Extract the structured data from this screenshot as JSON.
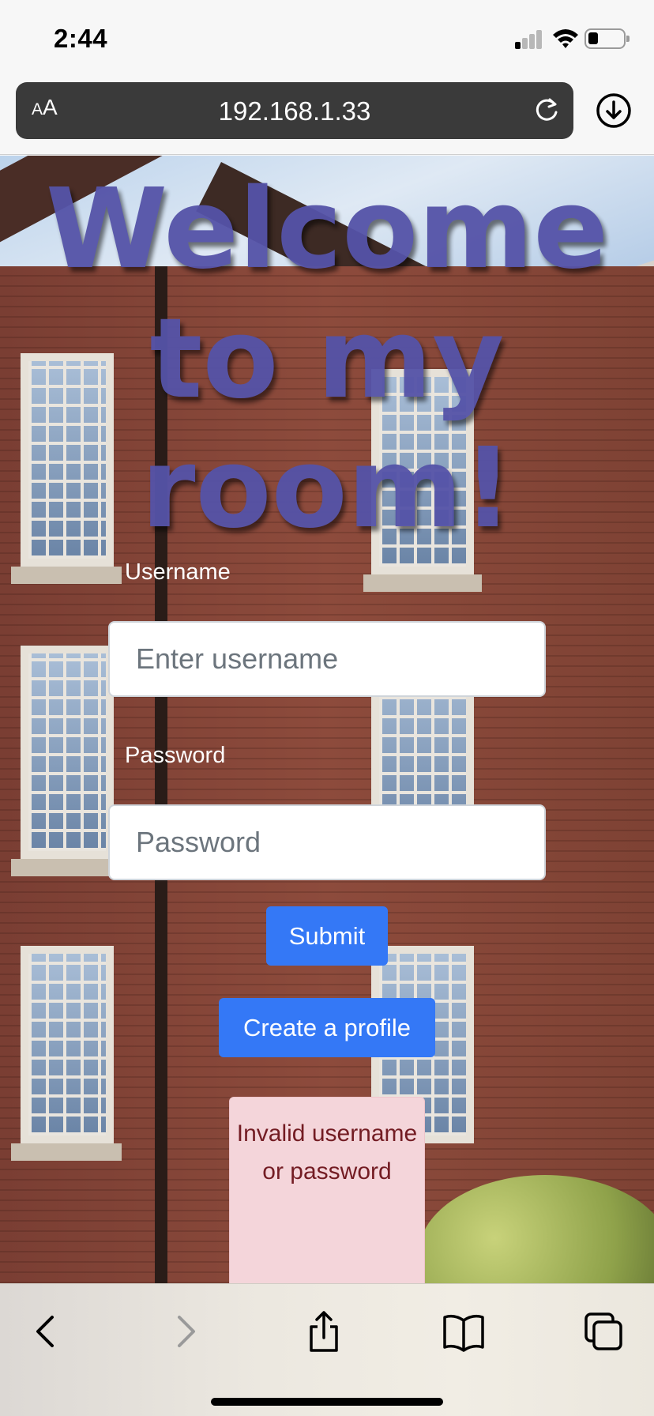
{
  "status_bar": {
    "time": "2:44"
  },
  "browser": {
    "text_size_label": "AA",
    "url": "192.168.1.33"
  },
  "page": {
    "heading": "Welcome to my room!",
    "username": {
      "label": "Username",
      "placeholder": "Enter username",
      "value": ""
    },
    "password": {
      "label": "Password",
      "placeholder": "Password",
      "value": ""
    },
    "submit_label": "Submit",
    "create_profile_label": "Create a profile",
    "error_message": "Invalid username or password"
  },
  "colors": {
    "heading": "#5553a8",
    "button": "#3478f6",
    "alert_bg": "#f4d5da",
    "alert_text": "#731c23"
  },
  "icons": {
    "toolbar": [
      "back-icon",
      "forward-icon",
      "share-icon",
      "bookmarks-icon",
      "tabs-icon"
    ]
  }
}
